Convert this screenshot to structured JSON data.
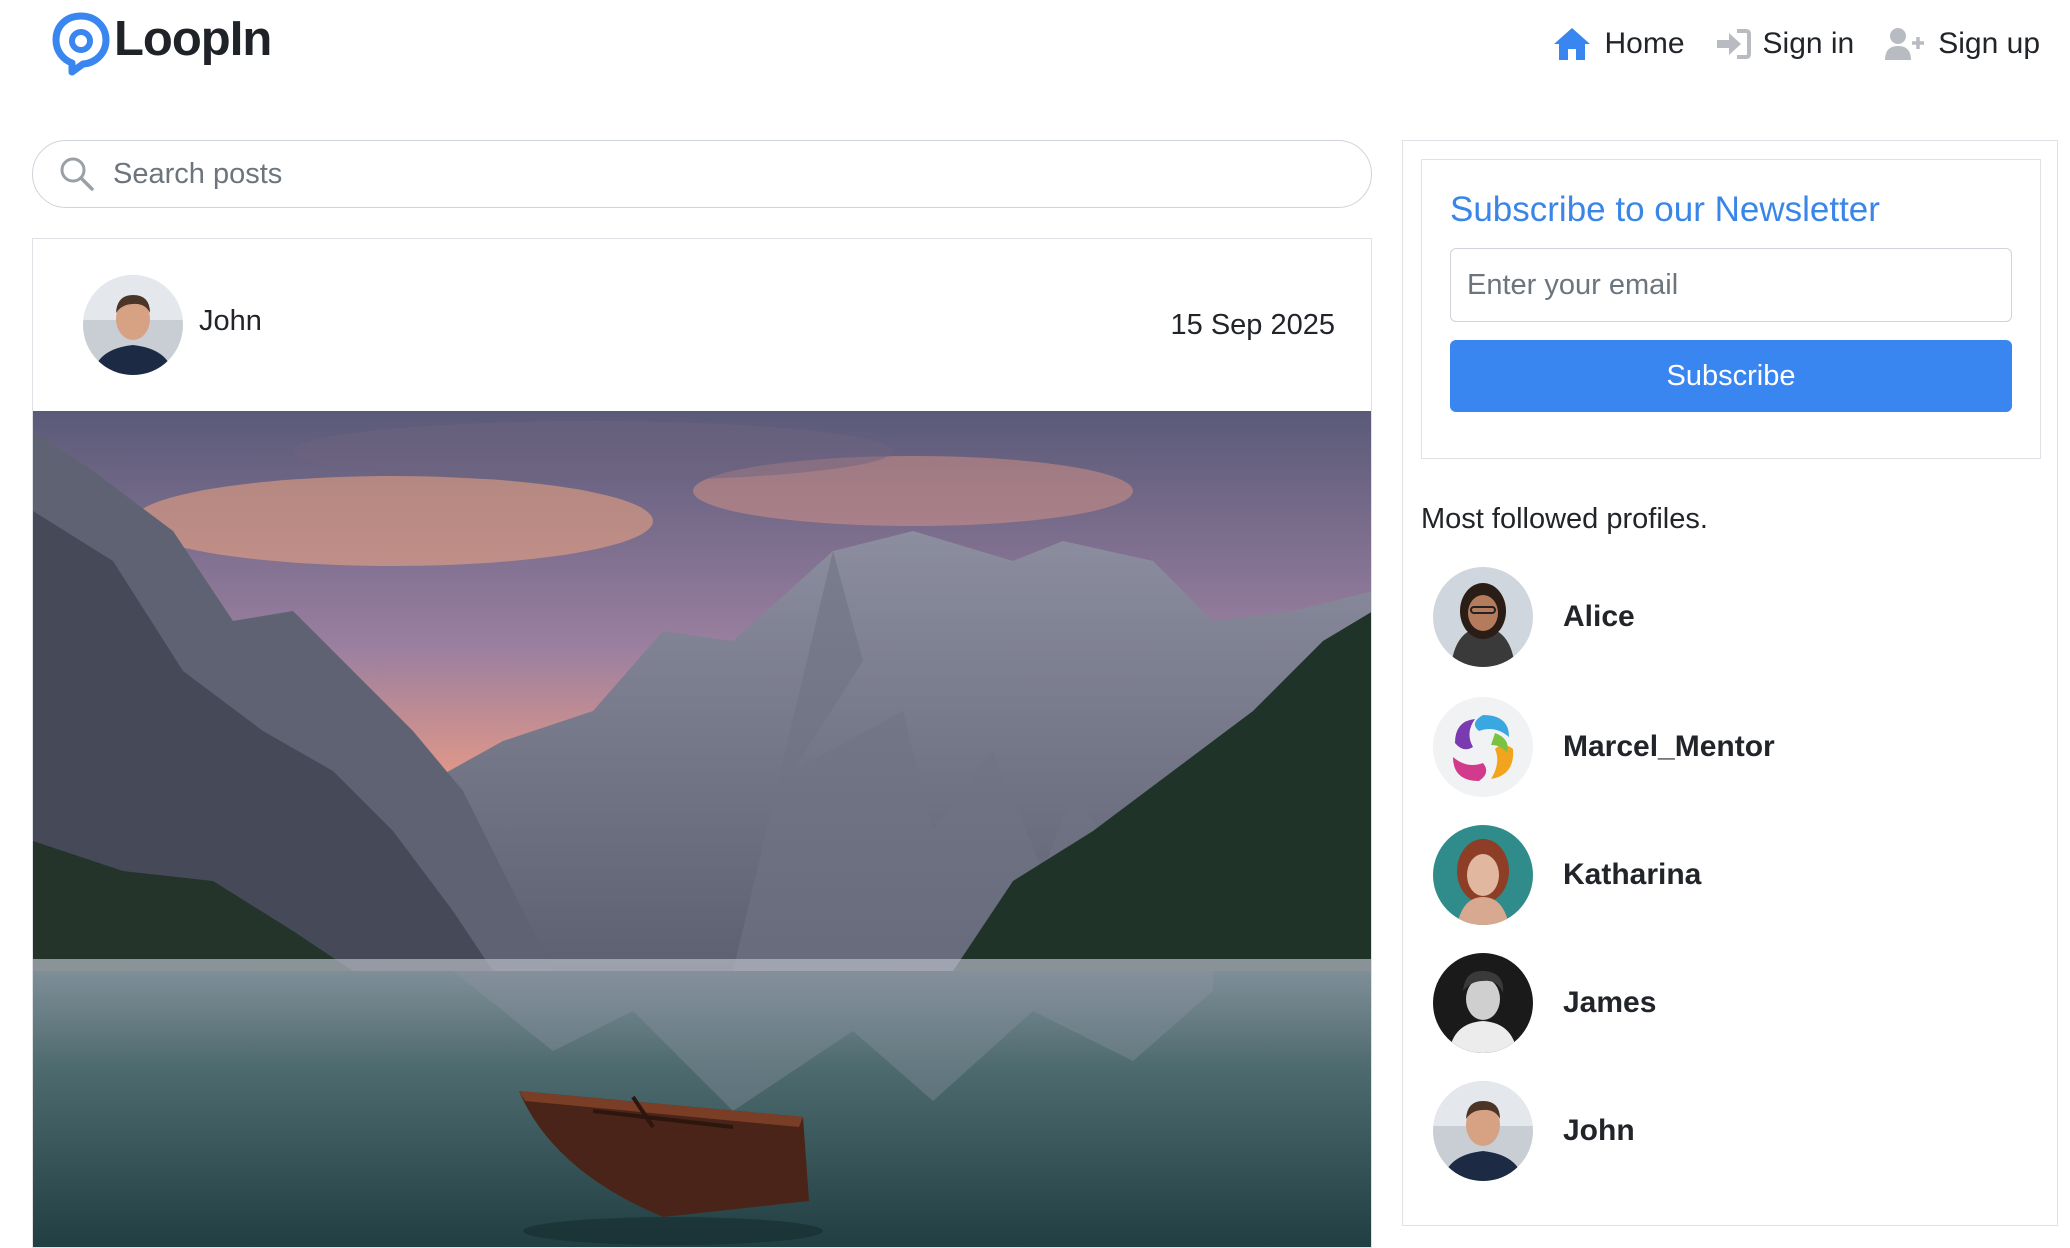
{
  "brand": {
    "name": "LoopIn",
    "accent": "#3a86f0"
  },
  "nav": {
    "home": {
      "label": "Home",
      "icon": "home-icon"
    },
    "signin": {
      "label": "Sign in",
      "icon": "sign-in-icon"
    },
    "signup": {
      "label": "Sign up",
      "icon": "user-plus-icon"
    }
  },
  "search": {
    "placeholder": "Search posts",
    "value": ""
  },
  "post": {
    "author": "John",
    "date": "15 Sep 2025",
    "image": "mountain lake with wooden boat at sunset"
  },
  "newsletter": {
    "title": "Subscribe to our Newsletter",
    "email_placeholder": "Enter your email",
    "button_label": "Subscribe"
  },
  "profiles": {
    "title": "Most followed profiles.",
    "items": [
      {
        "name": "Alice"
      },
      {
        "name": "Marcel_Mentor"
      },
      {
        "name": "Katharina"
      },
      {
        "name": "James"
      },
      {
        "name": "John"
      }
    ]
  }
}
